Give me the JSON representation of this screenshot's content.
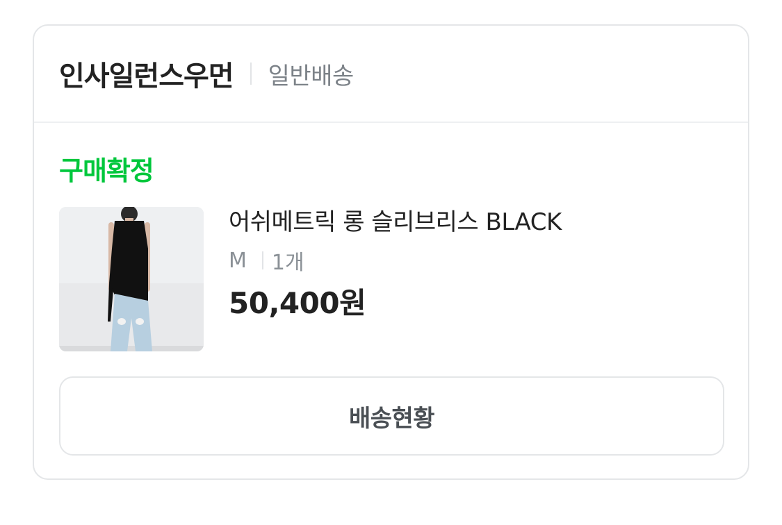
{
  "header": {
    "seller_name": "인사일런스우먼",
    "shipping_type": "일반배송"
  },
  "order": {
    "status": "구매확정",
    "status_color": "#00c73c"
  },
  "product": {
    "image_icon": "product-photo",
    "name": "어쉬메트릭 롱 슬리브리스 BLACK",
    "option": "M",
    "quantity": "1개",
    "price": "50,400원"
  },
  "actions": {
    "track_label": "배송현황"
  }
}
